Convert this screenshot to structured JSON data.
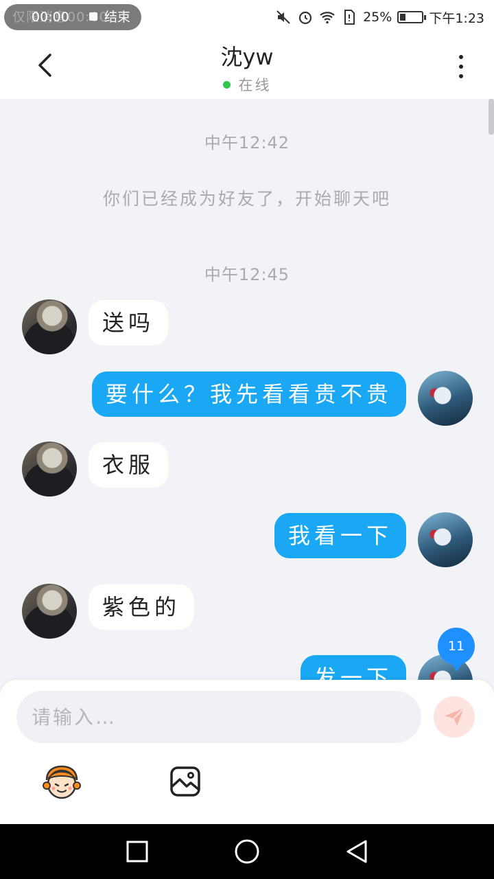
{
  "status_bar": {
    "recording_time": "00:00",
    "recording_under": "仅限消息00:00",
    "end_label": "结束",
    "battery": "25%",
    "clock": "下午1:23",
    "icons": [
      "mute-icon",
      "alarm-icon",
      "wifi-icon",
      "sim-icon",
      "battery-icon"
    ]
  },
  "header": {
    "title": "沈yw",
    "status": "在线"
  },
  "chat": {
    "timestamp_1": "中午12:42",
    "system_message": "你们已经成为好友了，开始聊天吧",
    "timestamp_2": "中午12:45",
    "messages": [
      {
        "side": "in",
        "text": "送吗"
      },
      {
        "side": "out",
        "text": "要什么？我先看看贵不贵"
      },
      {
        "side": "in",
        "text": "衣服"
      },
      {
        "side": "out",
        "text": "我看一下"
      },
      {
        "side": "in",
        "text": "紫色的"
      },
      {
        "side": "out",
        "text": "发一下"
      }
    ],
    "unread_badge": "11"
  },
  "composer": {
    "placeholder": "请输入…",
    "value": ""
  },
  "colors": {
    "outgoing_bubble": "#1aa7f3",
    "background": "#f2f3f7",
    "online_dot": "#2dc84d",
    "badge": "#1e90ff"
  }
}
